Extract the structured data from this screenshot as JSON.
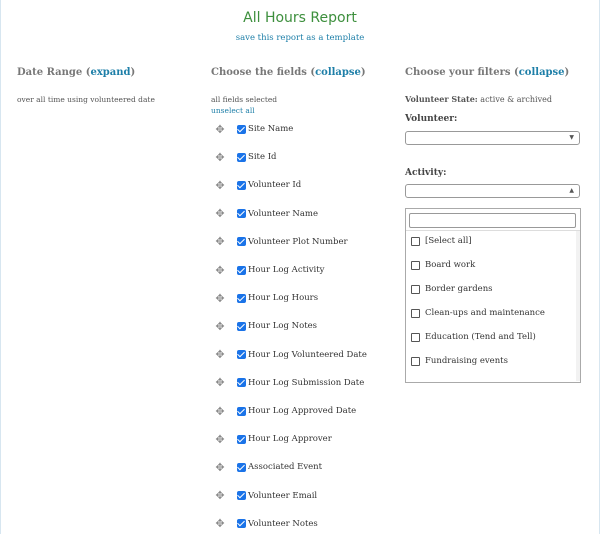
{
  "report": {
    "title": "All Hours Report",
    "save_template_link": "save this report as a template"
  },
  "date_range": {
    "heading": "Date Range",
    "toggle": "expand",
    "description": "over all time using volunteered date"
  },
  "fields": {
    "heading": "Choose the fields",
    "toggle": "collapse",
    "status": "all fields selected",
    "unselect_link": "unselect all",
    "items": [
      {
        "label": "Site Name",
        "checked": true
      },
      {
        "label": "Site Id",
        "checked": true
      },
      {
        "label": "Volunteer Id",
        "checked": true
      },
      {
        "label": "Volunteer Name",
        "checked": true
      },
      {
        "label": "Volunteer Plot Number",
        "checked": true
      },
      {
        "label": "Hour Log Activity",
        "checked": true
      },
      {
        "label": "Hour Log Hours",
        "checked": true
      },
      {
        "label": "Hour Log Notes",
        "checked": true
      },
      {
        "label": "Hour Log Volunteered Date",
        "checked": true
      },
      {
        "label": "Hour Log Submission Date",
        "checked": true
      },
      {
        "label": "Hour Log Approved Date",
        "checked": true
      },
      {
        "label": "Hour Log Approver",
        "checked": true
      },
      {
        "label": "Associated Event",
        "checked": true
      },
      {
        "label": "Volunteer Email",
        "checked": true
      },
      {
        "label": "Volunteer Notes",
        "checked": true
      }
    ]
  },
  "filters": {
    "heading": "Choose your filters",
    "toggle": "collapse",
    "volunteer_state_label": "Volunteer State:",
    "volunteer_state_value": "active & archived",
    "volunteer_label": "Volunteer:",
    "volunteer_value": "",
    "activity_label": "Activity:",
    "activity_value": "",
    "activity_search_value": "",
    "activity_options": [
      {
        "label": "[Select all]",
        "checked": false
      },
      {
        "label": "Board work",
        "checked": false
      },
      {
        "label": "Border gardens",
        "checked": false
      },
      {
        "label": "Clean-ups and maintenance",
        "checked": false
      },
      {
        "label": "Education (Tend and Tell)",
        "checked": false
      },
      {
        "label": "Fundraising events",
        "checked": false
      }
    ]
  },
  "icons": {
    "drag": "drag-handle-icon",
    "checkbox": "checkbox-checked-icon",
    "select_arrow": "caret-down-icon",
    "dropdown_open_arrow": "caret-up-icon"
  },
  "colors": {
    "title": "#3d8f3d",
    "link": "#1e7fa8",
    "checkbox": "#1a73e8"
  }
}
